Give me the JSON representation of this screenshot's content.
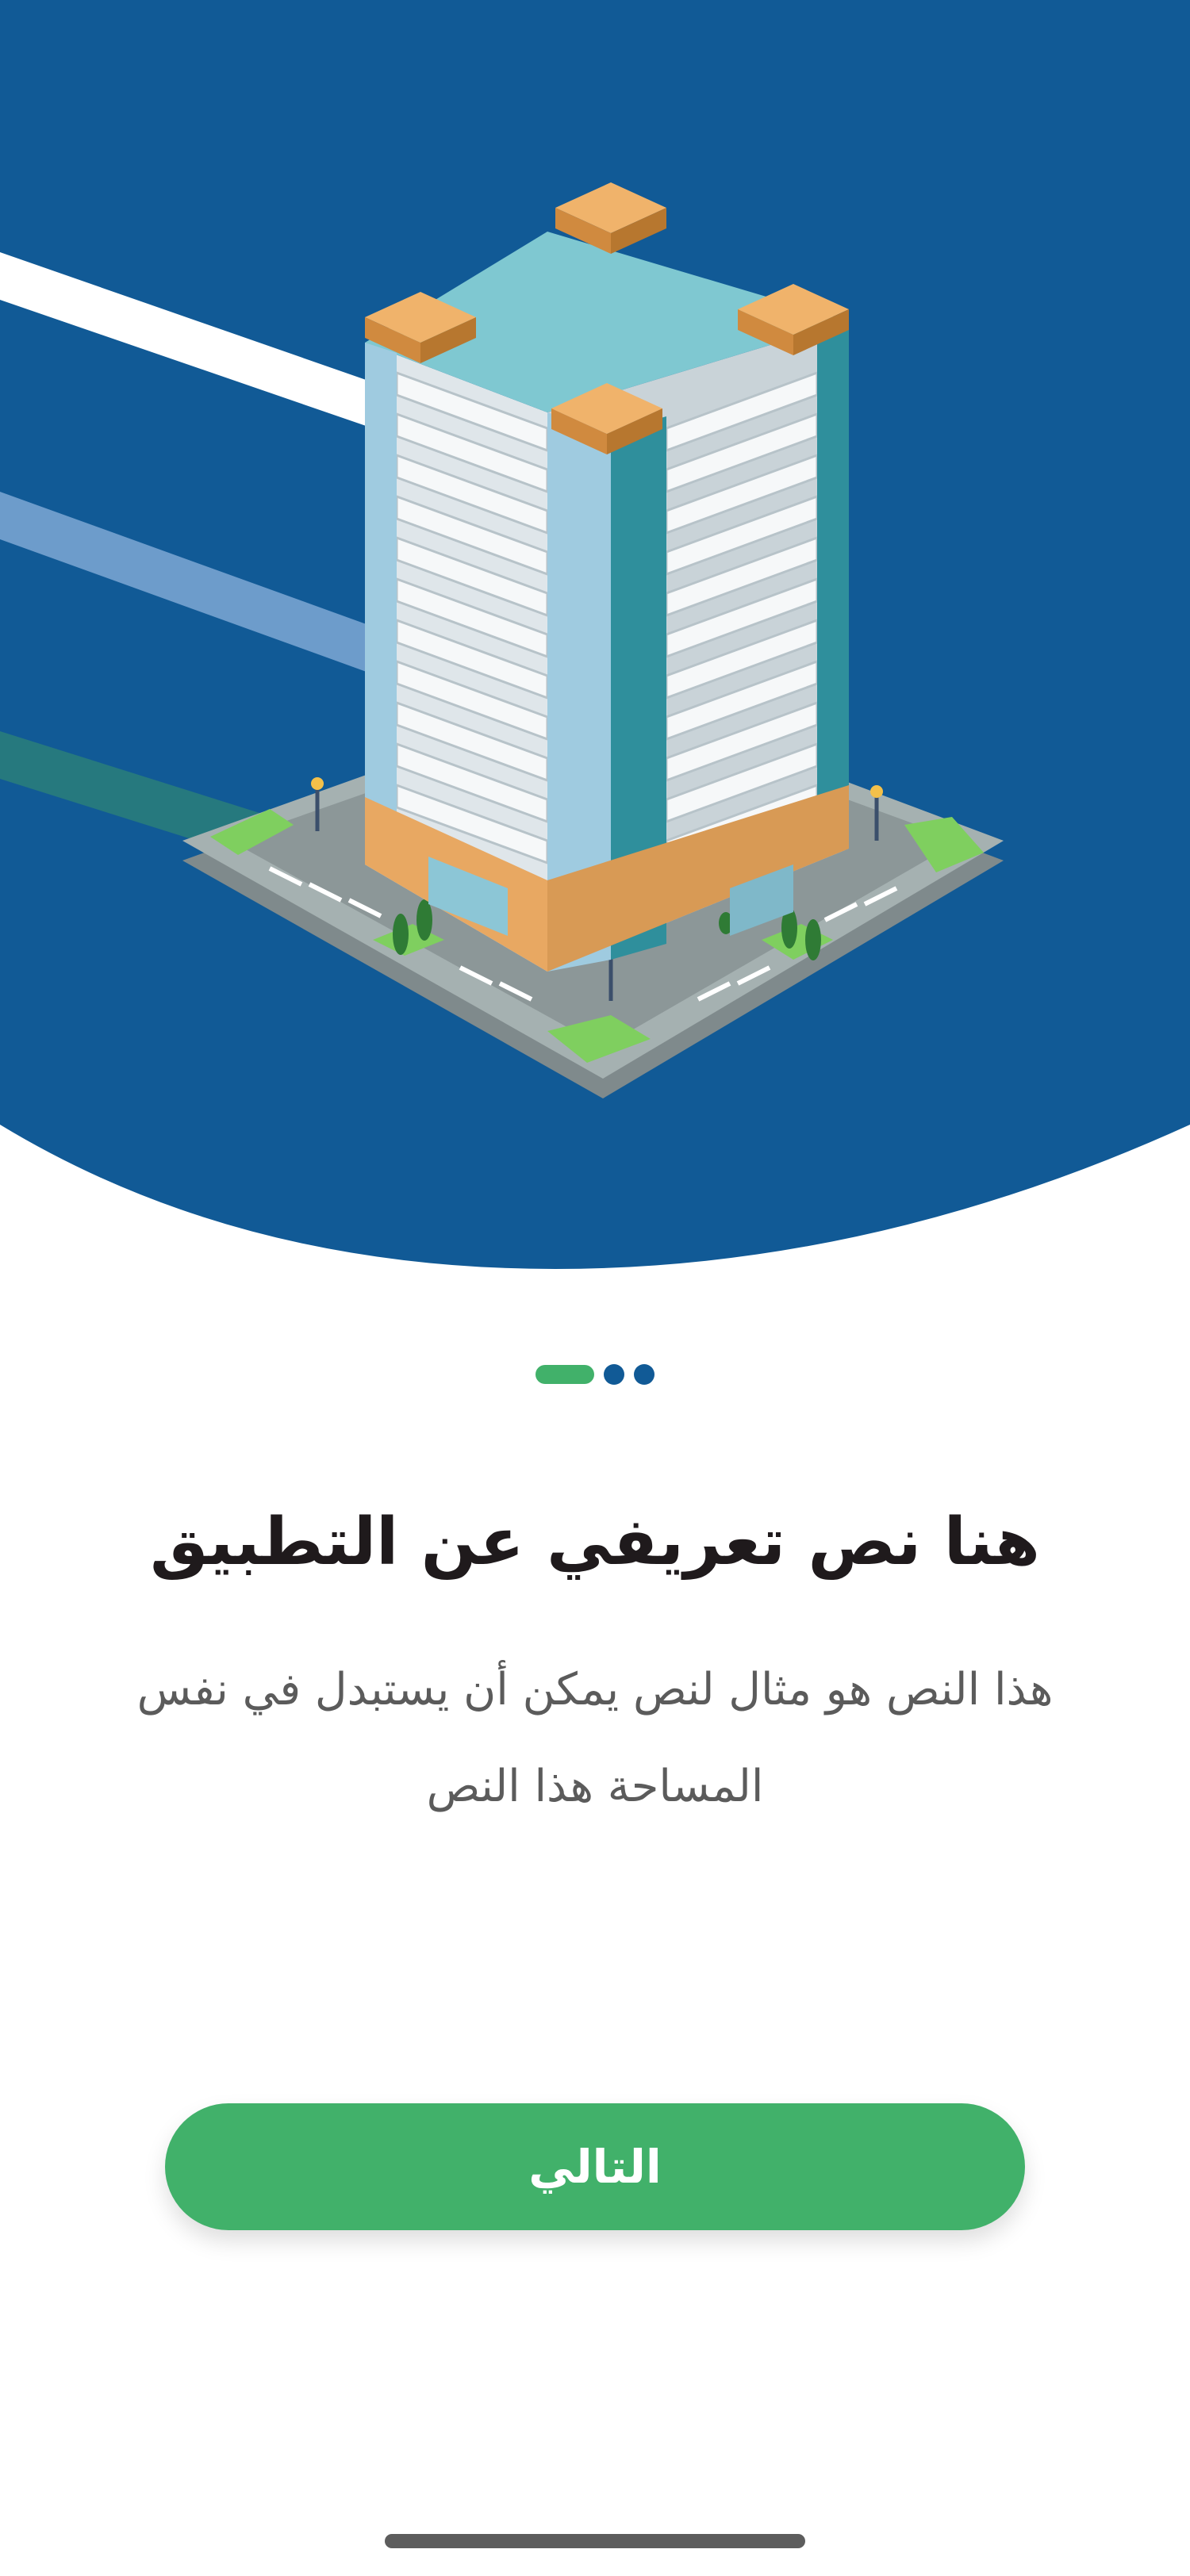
{
  "theme": {
    "hero_color": "#115a96",
    "accent_green": "#41b16a",
    "title_color": "#1f1a1c",
    "text_color": "#5b5b5b"
  },
  "hero": {
    "illustration": "isometric-building-illustration"
  },
  "pager": {
    "pages": 3,
    "active_index": 0
  },
  "onboarding": {
    "title": "هنا نص تعريفي عن التطبيق",
    "description": "هذا النص هو مثال لنص يمكن أن يستبدل في نفس المساحة هذا النص"
  },
  "actions": {
    "next_label": "التالي"
  }
}
